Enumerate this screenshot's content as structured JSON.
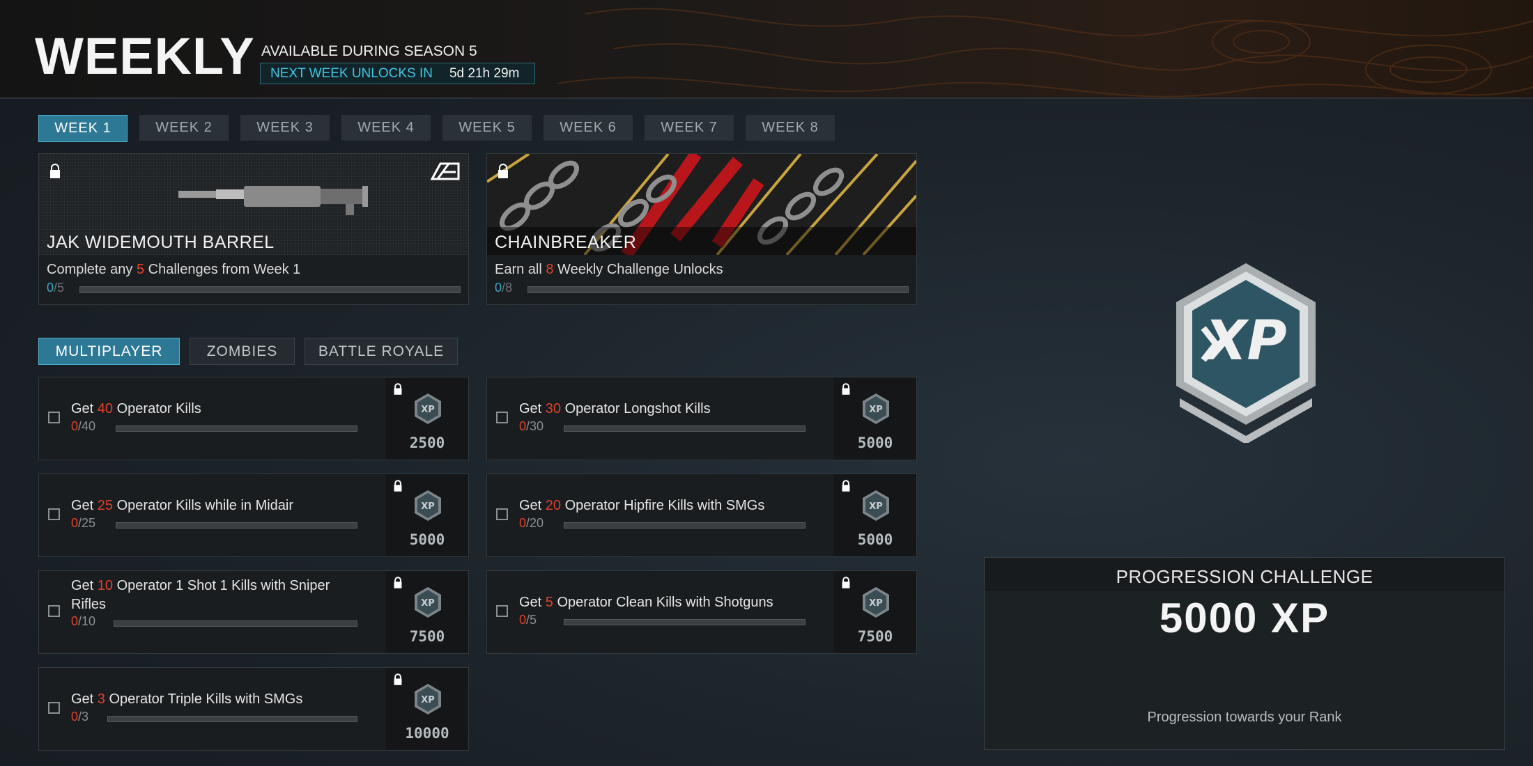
{
  "header": {
    "title": "WEEKLY",
    "season": "AVAILABLE DURING SEASON 5",
    "unlock_label": "NEXT WEEK UNLOCKS IN",
    "unlock_time": "5d 21h 29m"
  },
  "week_tabs": [
    "WEEK 1",
    "WEEK 2",
    "WEEK 3",
    "WEEK 4",
    "WEEK 5",
    "WEEK 6",
    "WEEK 7",
    "WEEK 8"
  ],
  "active_week": "WEEK 1",
  "rewards": [
    {
      "name": "JAK WIDEMOUTH BARREL",
      "desc_pre": "Complete any ",
      "desc_num": "5",
      "desc_post": " Challenges from Week 1",
      "current": "0",
      "total": "/5",
      "progress": 0,
      "icon": "weapon-barrel-icon",
      "brand_icon": "brand-logo-icon"
    },
    {
      "name": "CHAINBREAKER",
      "desc_pre": "Earn all ",
      "desc_num": "8",
      "desc_post": " Weekly Challenge Unlocks",
      "current": "0",
      "total": "/8",
      "progress": 0,
      "icon": "camo-chains-icon"
    }
  ],
  "mode_tabs": [
    "MULTIPLAYER",
    "ZOMBIES",
    "BATTLE ROYALE"
  ],
  "active_mode": "MULTIPLAYER",
  "challenges": [
    {
      "pre": "Get ",
      "num": "40",
      "post": " Operator Kills",
      "current": "0",
      "total": "/40",
      "xp": "2500",
      "progress": 0
    },
    {
      "pre": "Get ",
      "num": "30",
      "post": " Operator Longshot Kills",
      "current": "0",
      "total": "/30",
      "xp": "5000",
      "progress": 0
    },
    {
      "pre": "Get ",
      "num": "25",
      "post": " Operator Kills while in Midair",
      "current": "0",
      "total": "/25",
      "xp": "5000",
      "progress": 0
    },
    {
      "pre": "Get ",
      "num": "20",
      "post": " Operator Hipfire Kills with SMGs",
      "current": "0",
      "total": "/20",
      "xp": "5000",
      "progress": 0
    },
    {
      "pre": "Get ",
      "num": "10",
      "post": " Operator 1 Shot 1 Kills with Sniper Rifles",
      "current": "0",
      "total": "/10",
      "xp": "7500",
      "progress": 0
    },
    {
      "pre": "Get ",
      "num": "5",
      "post": " Operator Clean Kills with Shotguns",
      "current": "0",
      "total": "/5",
      "xp": "7500",
      "progress": 0
    },
    {
      "pre": "Get ",
      "num": "3",
      "post": " Operator Triple Kills with SMGs",
      "current": "0",
      "total": "/3",
      "xp": "10000",
      "progress": 0
    }
  ],
  "progression": {
    "title": "PROGRESSION CHALLENGE",
    "xp": "5000 XP",
    "desc": "Progression towards your Rank",
    "badge_icon": "xp-badge-icon"
  },
  "colors": {
    "accent": "#2d7895",
    "highlight": "#43c4e3",
    "number": "#e0402b"
  }
}
